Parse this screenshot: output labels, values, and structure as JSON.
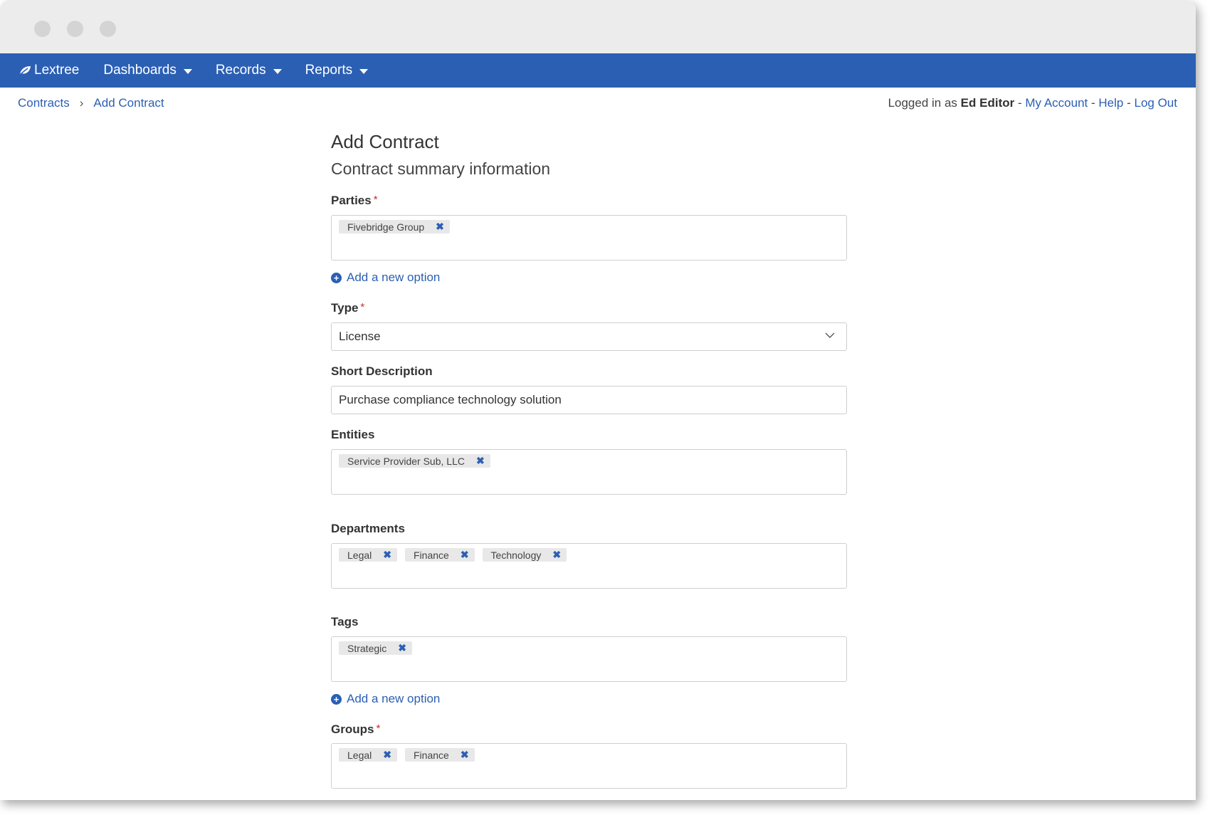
{
  "brand": {
    "name": "Lextree",
    "icon": "leaf-icon"
  },
  "nav": {
    "items": [
      {
        "label": "Dashboards"
      },
      {
        "label": "Records"
      },
      {
        "label": "Reports"
      }
    ]
  },
  "breadcrumb": {
    "items": [
      {
        "label": "Contracts"
      },
      {
        "label": "Add Contract"
      }
    ]
  },
  "user": {
    "prefix": "Logged in as",
    "name": "Ed Editor",
    "sep": "-",
    "my_account": "My Account",
    "help": "Help",
    "logout": "Log Out"
  },
  "page": {
    "title": "Add Contract",
    "subtitle": "Contract summary information"
  },
  "form": {
    "parties": {
      "label": "Parties",
      "required": "*",
      "chips": [
        "Fivebridge Group"
      ],
      "add_option": "Add a new option"
    },
    "type": {
      "label": "Type",
      "required": "*",
      "value": "License"
    },
    "short_description": {
      "label": "Short Description",
      "value": "Purchase compliance technology solution"
    },
    "entities": {
      "label": "Entities",
      "chips": [
        "Service Provider Sub, LLC"
      ]
    },
    "departments": {
      "label": "Departments",
      "chips": [
        "Legal",
        "Finance",
        "Technology"
      ]
    },
    "tags": {
      "label": "Tags",
      "chips": [
        "Strategic"
      ],
      "add_option": "Add a new option"
    },
    "groups": {
      "label": "Groups",
      "required": "*",
      "chips": [
        "Legal",
        "Finance"
      ]
    }
  },
  "chip_remove_glyph": "✖",
  "colors": {
    "navbar": "#2b5fb4",
    "link": "#2b5fb4",
    "required": "#d9252b"
  }
}
